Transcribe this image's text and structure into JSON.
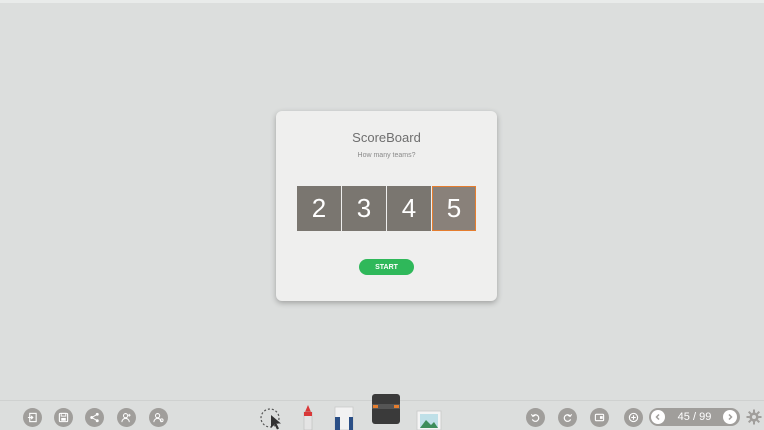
{
  "dialog": {
    "title": "ScoreBoard",
    "subtitle": "How many teams?",
    "team_options": [
      "2",
      "3",
      "4",
      "5"
    ],
    "selected_team": "5",
    "start_label": "START"
  },
  "toolbar": {
    "left_icons": [
      "exit-icon",
      "save-icon",
      "share-icon",
      "user-add-icon",
      "user-settings-icon"
    ],
    "center_tools": [
      "lasso-select-icon",
      "pen-icon",
      "highlighter-icon",
      "eraser-icon",
      "image-icon"
    ],
    "right_icons": [
      "undo-icon",
      "redo-icon",
      "screen-record-icon",
      "add-page-icon"
    ],
    "page_indicator": "45 / 99",
    "current_page": 45,
    "total_pages": 99
  },
  "colors": {
    "background": "#dcdedd",
    "dialog": "#efefee",
    "team_button": "#7a7670",
    "selected_border": "#e57d2e",
    "start_button": "#2fb85a",
    "toolbar_icon": "#a09e9b"
  }
}
